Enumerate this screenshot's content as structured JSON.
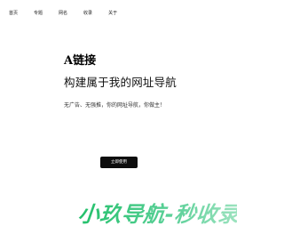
{
  "nav": {
    "items": [
      {
        "label": "首页"
      },
      {
        "label": "专题"
      },
      {
        "label": "网名"
      },
      {
        "label": "收录"
      },
      {
        "label": "关于"
      }
    ]
  },
  "hero": {
    "brand": "A链接",
    "headline": "构建属于我的网址导航",
    "description": "无广告、无强推，你的网址导航，你做主！"
  },
  "cta": {
    "label": "立即使用"
  },
  "banner": {
    "text": "小玖导航-秒收录"
  },
  "colors": {
    "accent": "#2fbf7a",
    "button_bg": "#0d0d0d"
  }
}
